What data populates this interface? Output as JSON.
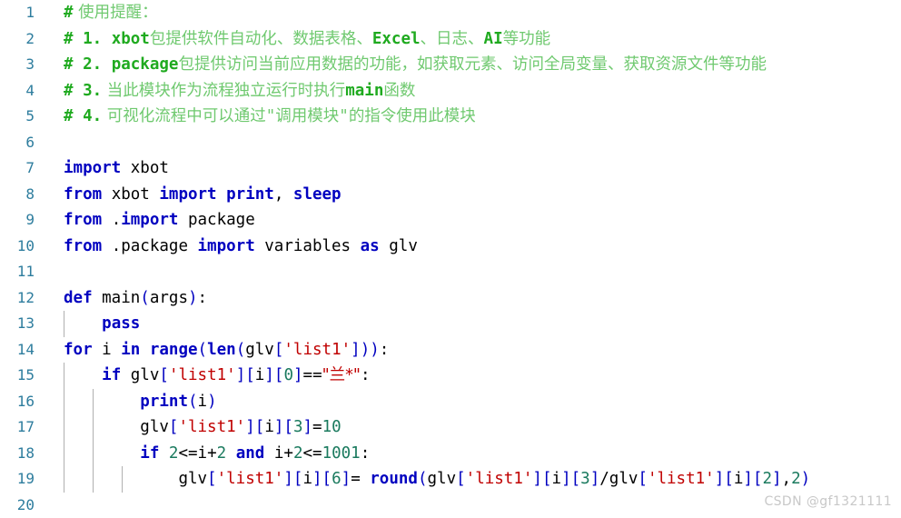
{
  "editor": {
    "language": "Python",
    "total_lines": 20,
    "colors": {
      "background": "#ffffff",
      "line_number": "#2e7d9e",
      "keyword": "#0000c0",
      "string": "#c00000",
      "number": "#1a7a5e",
      "comment_code": "#1faa1f",
      "comment_text": "#6fc96f",
      "indent_guide": "#b0b0b0",
      "watermark": "#c8c8c8"
    },
    "line_numbers": [
      "1",
      "2",
      "3",
      "4",
      "5",
      "6",
      "7",
      "8",
      "9",
      "10",
      "11",
      "12",
      "13",
      "14",
      "15",
      "16",
      "17",
      "18",
      "19",
      "20"
    ],
    "lines": [
      {
        "n": "1",
        "text": "# 使用提醒："
      },
      {
        "n": "2",
        "text": "# 1. xbot包提供软件自动化、数据表格、Excel、日志、AI等功能"
      },
      {
        "n": "3",
        "text": "# 2. package包提供访问当前应用数据的功能，如获取元素、访问全局变量、获取资源文件等功能"
      },
      {
        "n": "4",
        "text": "# 3. 当此模块作为流程独立运行时执行main函数"
      },
      {
        "n": "5",
        "text": "# 4. 可视化流程中可以通过\"调用模块\"的指令使用此模块"
      },
      {
        "n": "6",
        "text": ""
      },
      {
        "n": "7",
        "text": "import xbot"
      },
      {
        "n": "8",
        "text": "from xbot import print, sleep"
      },
      {
        "n": "9",
        "text": "from .import package"
      },
      {
        "n": "10",
        "text": "from .package import variables as glv"
      },
      {
        "n": "11",
        "text": ""
      },
      {
        "n": "12",
        "text": "def main(args):"
      },
      {
        "n": "13",
        "text": "    pass"
      },
      {
        "n": "14",
        "text": "for i in range(len(glv['list1'])):"
      },
      {
        "n": "15",
        "text": "    if glv['list1'][i][0]==\"兰*\":"
      },
      {
        "n": "16",
        "text": "        print(i)"
      },
      {
        "n": "17",
        "text": "        glv['list1'][i][3]=10"
      },
      {
        "n": "18",
        "text": "        if 2<=i+2 and i+2<=1001:"
      },
      {
        "n": "19",
        "text": "            glv['list1'][i][6]= round(glv['list1'][i][3]/glv['list1'][i][2],2)"
      },
      {
        "n": "20",
        "text": ""
      }
    ],
    "tokens": {
      "l1": {
        "hash": "#",
        "text": " 使用提醒："
      },
      "l2": {
        "hash": "#",
        "num": " 1.",
        "code1": " xbot",
        "t1": "包提供软件自动化、数据表格、",
        "code2": "Excel",
        "t2": "、日志、",
        "code3": "AI",
        "t3": "等功能"
      },
      "l3": {
        "hash": "#",
        "num": " 2.",
        "code1": " package",
        "t1": "包提供访问当前应用数据的功能，如获取元素、访问全局变量、获取资源文件等功能"
      },
      "l4": {
        "hash": "#",
        "num": " 3.",
        "t1": " 当此模块作为流程独立运行时执行",
        "code1": "main",
        "t2": "函数"
      },
      "l5": {
        "hash": "#",
        "num": " 4.",
        "t1": " 可视化流程中可以通过",
        "q1": "\"",
        "t2": "调用模块",
        "q2": "\"",
        "t3": "的指令使用此模块"
      },
      "l7": {
        "kw": "import",
        "plain": " xbot"
      },
      "l8": {
        "kw1": "from",
        "p1": " xbot ",
        "kw2": "import",
        "p2": " ",
        "kw3": "print",
        "p3": ", ",
        "kw4": "sleep"
      },
      "l9": {
        "kw1": "from",
        "p1": " .",
        "kw2": "import",
        "p2": " package"
      },
      "l10": {
        "kw1": "from",
        "p1": " .package ",
        "kw2": "import",
        "p2": " variables ",
        "kw3": "as",
        "p3": " glv"
      },
      "l12": {
        "kw": "def",
        "p1": " main",
        "b1": "(",
        "p2": "args",
        "b2": ")",
        "p3": ":"
      },
      "l13": {
        "kw": "pass"
      },
      "l14": {
        "kw1": "for",
        "p1": " i ",
        "kw2": "in",
        "p2": " ",
        "b1": "range",
        "b2": "(",
        "b3": "len",
        "b4": "(",
        "p3": "glv",
        "b5": "[",
        "s1": "'list1'",
        "b6": "]",
        "b7": ")",
        "b8": ")",
        "p4": ":"
      },
      "l15": {
        "kw": "if",
        "p1": " glv",
        "b1": "[",
        "s1": "'list1'",
        "b2": "]",
        "b3": "[",
        "p2": "i",
        "b4": "]",
        "b5": "[",
        "n1": "0",
        "b6": "]",
        "p3": "==",
        "s2": "\"兰*\"",
        "p4": ":"
      },
      "l16": {
        "b1": "print",
        "b2": "(",
        "p1": "i",
        "b3": ")"
      },
      "l17": {
        "p1": "glv",
        "b1": "[",
        "s1": "'list1'",
        "b2": "]",
        "b3": "[",
        "p2": "i",
        "b4": "]",
        "b5": "[",
        "n1": "3",
        "b6": "]",
        "p3": "=",
        "n2": "10"
      },
      "l18": {
        "kw1": "if",
        "p1": " ",
        "n1": "2",
        "p2": "<=i+",
        "n2": "2",
        "p3": " ",
        "kw2": "and",
        "p4": " i+",
        "n3": "2",
        "p5": "<=",
        "n4": "1001",
        "p6": ":"
      },
      "l19": {
        "p1": "glv",
        "b1": "[",
        "s1": "'list1'",
        "b2": "]",
        "b3": "[",
        "p2": "i",
        "b4": "]",
        "b5": "[",
        "n1": "6",
        "b6": "]",
        "p3": "= ",
        "f1": "round",
        "b7": "(",
        "p4": "glv",
        "b8": "[",
        "s2": "'list1'",
        "b9": "]",
        "b10": "[",
        "p5": "i",
        "b11": "]",
        "b12": "[",
        "n2": "3",
        "b13": "]",
        "p6": "/glv",
        "b14": "[",
        "s3": "'list1'",
        "b15": "]",
        "b16": "[",
        "p7": "i",
        "b17": "]",
        "b18": "[",
        "n3": "2",
        "b19": "]",
        "p8": ",",
        "n4": "2",
        "b20": ")"
      }
    }
  },
  "watermark": {
    "text": "CSDN @gf1321111"
  }
}
